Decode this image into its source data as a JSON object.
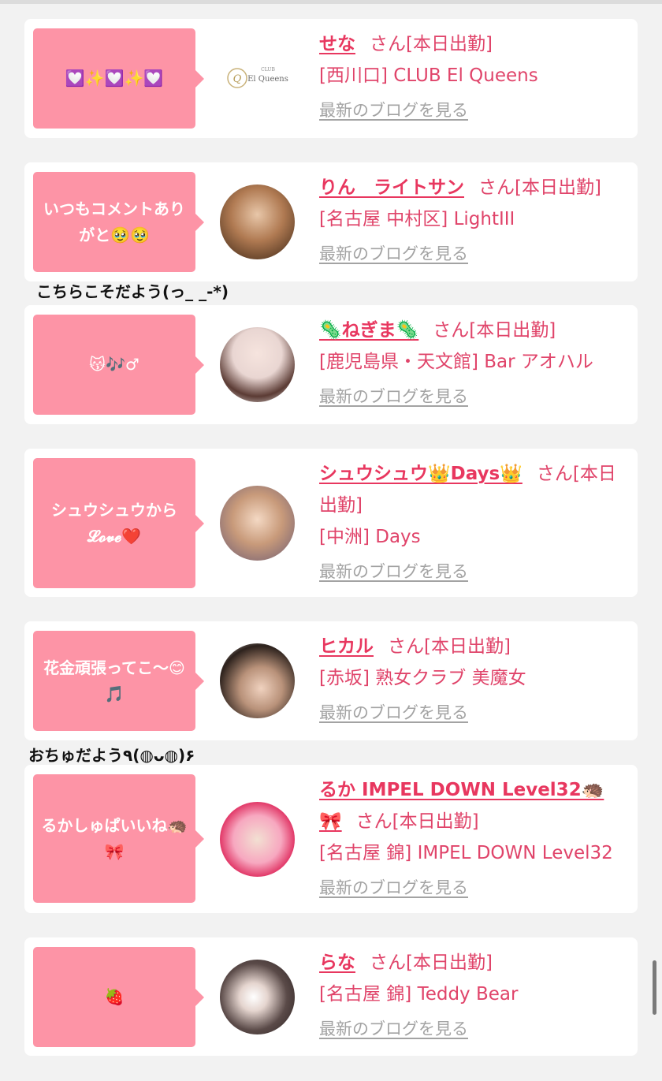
{
  "entries": [
    {
      "comment": "💟✨💟✨💟",
      "name": "せな",
      "san": "さん[本日出勤]",
      "shop": "[西川口] CLUB El Queens",
      "blog": "最新のブログを見る",
      "logo_small": "CLUB",
      "logo_main": "El Queens"
    },
    {
      "comment": "いつもコメントありがと🥹🥹",
      "name": "りん　ライトサン",
      "san": "さん[本日出勤]",
      "shop": "[名古屋 中村区] LightIII",
      "blog": "最新のブログを見る"
    },
    {
      "comment": "😽🎶♂",
      "name": "🦠ねぎま🦠",
      "san": "さん[本日出勤]",
      "shop": "[鹿児島県・天文館] Bar アオハル",
      "blog": "最新のブログを見る"
    },
    {
      "comment": "シュウシュウから 𝓛𝓸𝓿𝓮❤️",
      "name": "シュウシュウ👑Days👑",
      "san": "さん[本日出勤]",
      "shop": "[中洲] Days",
      "blog": "最新のブログを見る"
    },
    {
      "comment": "花金頑張ってこ〜😊🎵",
      "name": "ヒカル",
      "san": "さん[本日出勤]",
      "shop": "[赤坂] 熟女クラブ 美魔女",
      "blog": "最新のブログを見る"
    },
    {
      "comment": "るかしゅぱいいね🦔🎀",
      "name": "るか IMPEL DOWN Level32🦔🎀",
      "san": "さん[本日出勤]",
      "shop": "[名古屋 錦] IMPEL DOWN Level32",
      "blog": "最新のブログを見る"
    },
    {
      "comment": "🍓",
      "name": "らな",
      "san": "さん[本日出勤]",
      "shop": "[名古屋 錦] Teddy Bear",
      "blog": "最新のブログを見る"
    }
  ],
  "replies": [
    "こちらこそだよう(っ_ _-*)",
    "おちゅだよう٩(◍ᴗ◍)۶"
  ],
  "colors": {
    "bubble": "#fd94a6",
    "name": "#e8375f",
    "text_pink": "#e0446a",
    "link_gray": "#a3a3a3",
    "background": "#f2f2f2"
  }
}
